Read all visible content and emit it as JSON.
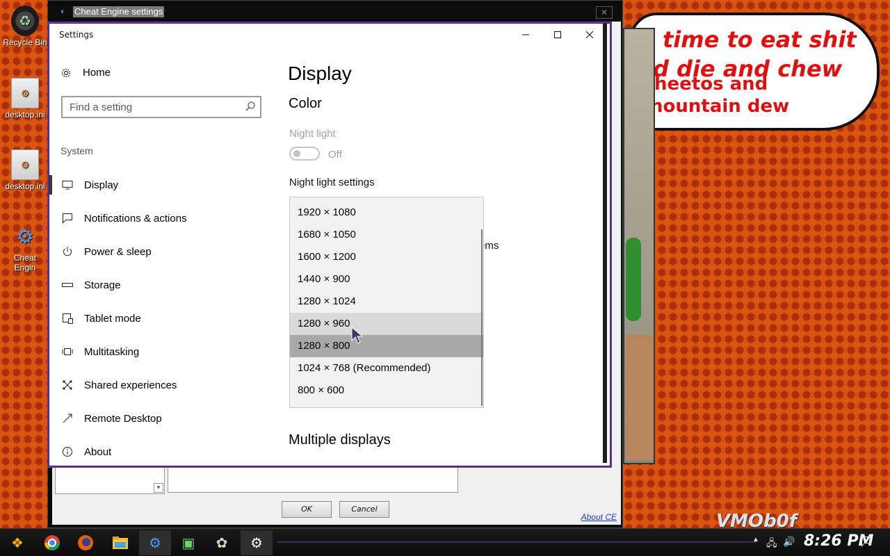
{
  "desktop": {
    "icons": [
      {
        "label": "Recycle Bin"
      },
      {
        "label": "desktop.ini"
      },
      {
        "label": "desktop.ini"
      },
      {
        "label": "Cheat Engin"
      }
    ]
  },
  "comic": {
    "line1": "time to eat shit",
    "line2": "d die and chew",
    "line3": "heetos and",
    "line4": "nountain dew",
    "watermark": "VMOb0f"
  },
  "cheat_engine": {
    "title": "Cheat Engine settings",
    "ok_label": "OK",
    "cancel_label": "Cancel",
    "about_link": "About CE"
  },
  "settings": {
    "window_title": "Settings",
    "home_label": "Home",
    "search_placeholder": "Find a setting",
    "system_label": "System",
    "nav": [
      {
        "label": "Display",
        "icon": "monitor-icon"
      },
      {
        "label": "Notifications & actions",
        "icon": "notification-icon"
      },
      {
        "label": "Power & sleep",
        "icon": "power-icon"
      },
      {
        "label": "Storage",
        "icon": "storage-icon"
      },
      {
        "label": "Tablet mode",
        "icon": "tablet-icon"
      },
      {
        "label": "Multitasking",
        "icon": "multitasking-icon"
      },
      {
        "label": "Shared experiences",
        "icon": "shared-icon"
      },
      {
        "label": "Remote Desktop",
        "icon": "remote-icon"
      },
      {
        "label": "About",
        "icon": "info-icon"
      }
    ],
    "active_nav": "Display"
  },
  "display_page": {
    "title": "Display",
    "color_heading": "Color",
    "night_light_label": "Night light",
    "night_light_state": "Off",
    "night_light_settings": "Night light settings",
    "partial_text": "ems",
    "multiple_displays": "Multiple displays",
    "resolution_options": [
      "1920 × 1080",
      "1680 × 1050",
      "1600 × 1200",
      "1440 × 900",
      "1280 × 1024",
      "1280 × 960",
      "1280 × 800",
      "1024 × 768 (Recommended)",
      "800 × 600"
    ],
    "hovered_option": "1280 × 960",
    "selected_option": "1280 × 800"
  },
  "taskbar": {
    "time": "8:26 PM",
    "apps": [
      "start-icon",
      "chrome-icon",
      "firefox-icon",
      "file-explorer-icon",
      "cheat-engine-icon",
      "app-icon",
      "game-icon",
      "settings-icon"
    ]
  }
}
